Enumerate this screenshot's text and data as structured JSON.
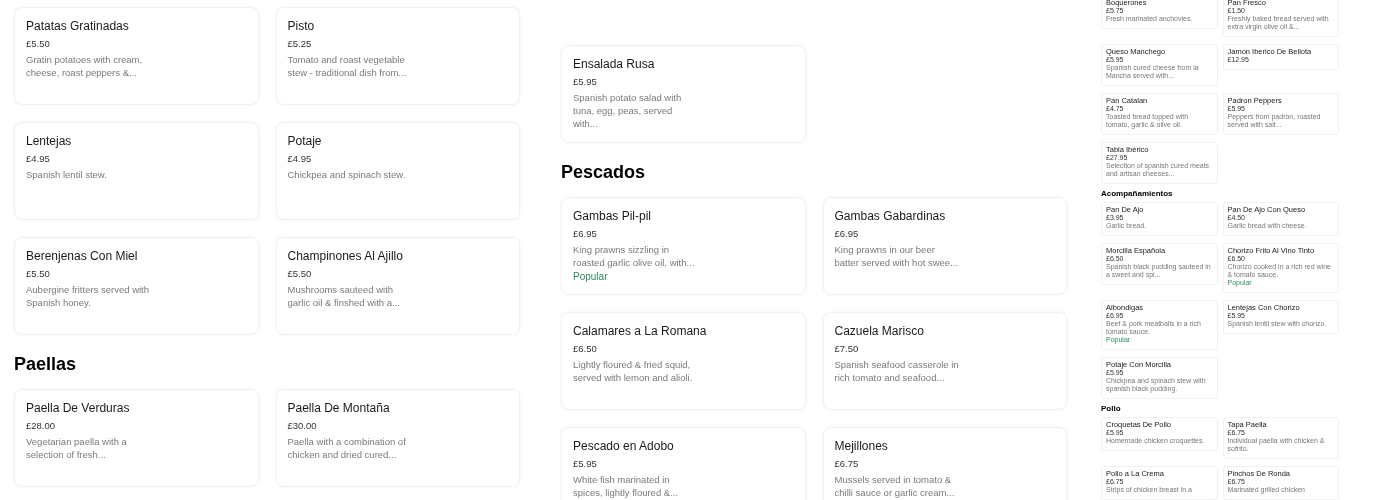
{
  "panels": [
    {
      "sections": [
        {
          "items": [
            {
              "name": "Patatas Gratinadas",
              "price": "£5.50",
              "description": "Gratin potatoes with cream, cheese, roast peppers &..."
            },
            {
              "name": "Pisto",
              "price": "£5.25",
              "description": "Tomato and roast vegetable stew - traditional dish from..."
            },
            {
              "name": "Lentejas",
              "price": "£4.95",
              "description": "Spanish lentil stew."
            },
            {
              "name": "Potaje",
              "price": "£4.95",
              "description": "Chickpea and spinach stew."
            },
            {
              "name": "Berenjenas Con Miel",
              "price": "£5.50",
              "description": "Aubergine fritters served with Spanish honey."
            },
            {
              "name": "Champinones Al Ajillo",
              "price": "£5.50",
              "description": "Mushrooms sauteed with garlic oil & finshed with a..."
            }
          ]
        },
        {
          "heading": "Paellas",
          "items": [
            {
              "name": "Paella De Verduras",
              "price": "£28.00",
              "description": "Vegetarian paella with a selection of fresh..."
            },
            {
              "name": "Paella De Montaña",
              "price": "£30.00",
              "description": "Paella with a combination of chicken and dried cured..."
            }
          ]
        }
      ]
    },
    {
      "sections": [
        {
          "items": [
            {
              "name": "Ensalada Rusa",
              "price": "£5.95",
              "description": "Spanish potato salad with tuna, egg, peas, served with..."
            }
          ]
        },
        {
          "heading": "Pescados",
          "items": [
            {
              "name": "Gambas Pil-pil",
              "price": "£6.95",
              "description": "King prawns sizzling in roasted garlic olive oil, with...",
              "badge": "Popular"
            },
            {
              "name": "Gambas Gabardinas",
              "price": "£6.95",
              "description": "King prawns in our beer batter served with hot swee..."
            },
            {
              "name": "Calamares a La Romana",
              "price": "£6.50",
              "description": "Lightly floured & fried squid, served with lemon and alioli."
            },
            {
              "name": "Cazuela Marisco",
              "price": "£7.50",
              "description": "Spanish seafood casserole in rich tomato and seafood..."
            },
            {
              "name": "Pescado en Adobo",
              "price": "£5.95",
              "description": "White fish marinated in spices, lightly floured &..."
            },
            {
              "name": "Mejillones",
              "price": "£6.75",
              "description": "Mussels served in tomato & chilli sauce or garlic cream..."
            }
          ]
        }
      ]
    },
    {
      "sections": [
        {
          "items": [
            {
              "name": "Boquerones",
              "price": "£5.75",
              "description": "Fresh marinated anchovies."
            },
            {
              "name": "Pan Fresco",
              "price": "£1.50",
              "description": "Freshly baked bread served with extra virgin olive oil &..."
            },
            {
              "name": "Queso Manchego",
              "price": "£5.95",
              "description": "Spanish cured cheese from la Mancha served with..."
            },
            {
              "name": "Jamon Iberico De Bellota",
              "price": "£12.95"
            },
            {
              "name": "Pan Catalan",
              "price": "£4.75",
              "description": "Toasted bread topped with tomato, garlic & olive oil."
            },
            {
              "name": "Padron Peppers",
              "price": "£5.95",
              "description": "Peppers from padron, roasted served with salt..."
            },
            {
              "name": "Tabla Ibérico",
              "price": "£27.95",
              "description": "Selection of spanish cured meats and artisan cheeses..."
            }
          ]
        },
        {
          "heading": "Acompañamientos",
          "items": [
            {
              "name": "Pan De Ajo",
              "price": "£3.95",
              "description": "Garlic bread."
            },
            {
              "name": "Pan De Ajo Con Queso",
              "price": "£4.50",
              "description": "Garlic bread with cheese."
            },
            {
              "name": "Morcilla Española",
              "price": "£6.50",
              "description": "Spanish black pudding sauteed in a sweet and spi..."
            },
            {
              "name": "Chorizo Frito Al Vino Tinto",
              "price": "£6.50",
              "description": "Chorizo cooked in a rich red wine & tomato sauce.",
              "badge": "Popular"
            },
            {
              "name": "Albondigas",
              "price": "£6.95",
              "description": "Beef & pork meatballs in a rich tomato sauce.",
              "badge": "Popular"
            },
            {
              "name": "Lentejas Con Chorizo",
              "price": "£5.95",
              "description": "Spanish lentil stew with chorizo."
            },
            {
              "name": "Potaje Con Morcilla",
              "price": "£5.95",
              "description": "Chickpea and spinach stew with spanish black pudding."
            }
          ]
        },
        {
          "heading": "Pollo",
          "items": [
            {
              "name": "Croquetas De Pollo",
              "price": "£5.95",
              "description": "Homemade chicken croquettes."
            },
            {
              "name": "Tapa Paella",
              "price": "£6.75",
              "description": "Individual paella with chicken & sofrito."
            },
            {
              "name": "Pollo a La Crema",
              "price": "£6.75",
              "description": "Strips of chicken breast in a"
            },
            {
              "name": "Pinchos De Ronda",
              "price": "£6.75",
              "description": "Marinated grilled chicken"
            }
          ]
        }
      ]
    }
  ]
}
